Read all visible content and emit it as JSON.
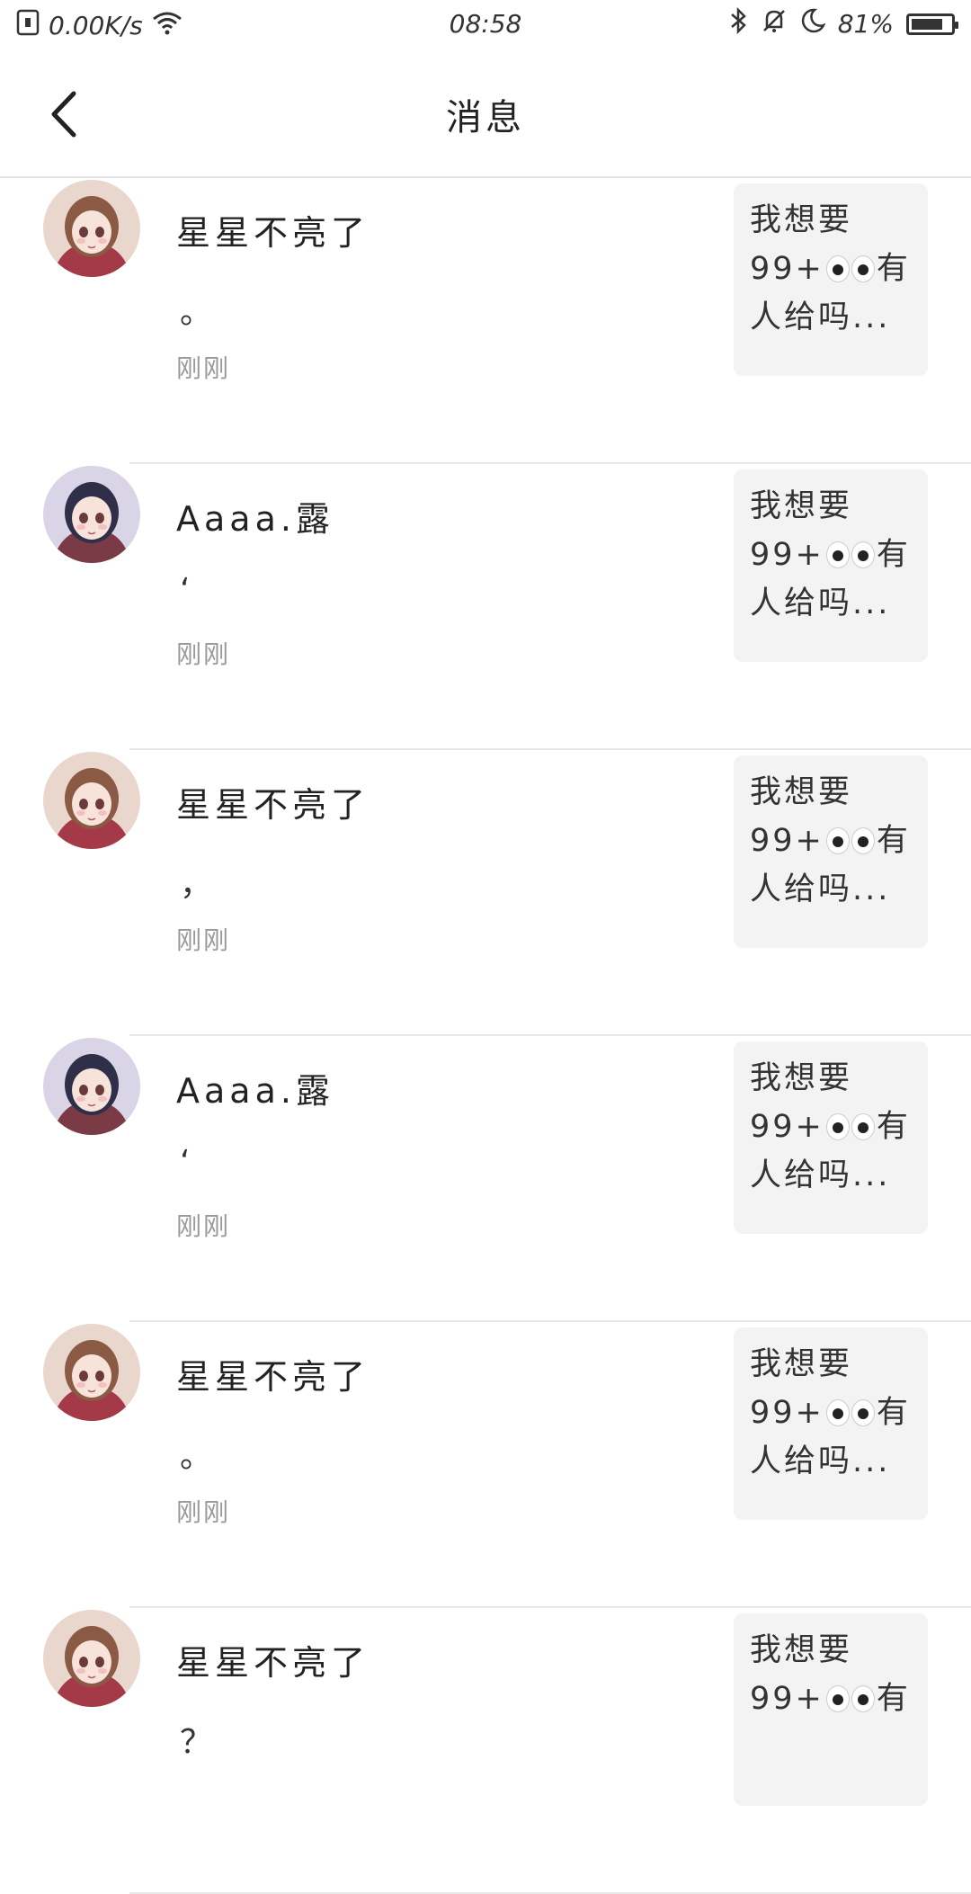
{
  "status_bar": {
    "net_speed": "0.00K/s",
    "time": "08:58",
    "battery": "81%",
    "battery_level": 0.81,
    "icons": [
      "sim-icon",
      "wifi-icon",
      "bluetooth-icon",
      "bell-off-icon",
      "moon-icon",
      "battery-icon"
    ]
  },
  "header": {
    "title": "消息",
    "back_icon": "chevron-left-icon"
  },
  "messages": [
    {
      "name": "星星不亮了",
      "avatar": "brown-hair-girl",
      "text": "。",
      "time": "刚刚",
      "preview": {
        "line1": "我想要",
        "line2_prefix": "99+",
        "line2_suffix": "有",
        "line3": "人给吗..."
      }
    },
    {
      "name": "Aaaa.露",
      "avatar": "dark-hair-girl",
      "text": "‘",
      "time": "刚刚",
      "preview": {
        "line1": "我想要",
        "line2_prefix": "99+",
        "line2_suffix": "有",
        "line3": "人给吗..."
      }
    },
    {
      "name": "星星不亮了",
      "avatar": "brown-hair-girl",
      "text": "，",
      "time": "刚刚",
      "preview": {
        "line1": "我想要",
        "line2_prefix": "99+",
        "line2_suffix": "有",
        "line3": "人给吗..."
      }
    },
    {
      "name": "Aaaa.露",
      "avatar": "dark-hair-girl",
      "text": "‘",
      "time": "刚刚",
      "preview": {
        "line1": "我想要",
        "line2_prefix": "99+",
        "line2_suffix": "有",
        "line3": "人给吗..."
      }
    },
    {
      "name": "星星不亮了",
      "avatar": "brown-hair-girl",
      "text": "。",
      "time": "刚刚",
      "preview": {
        "line1": "我想要",
        "line2_prefix": "99+",
        "line2_suffix": "有",
        "line3": "人给吗..."
      }
    },
    {
      "name": "星星不亮了",
      "avatar": "brown-hair-girl",
      "text": "？",
      "time": "",
      "preview": {
        "line1": "我想要",
        "line2_prefix": "99+",
        "line2_suffix": "有",
        "line3": ""
      }
    }
  ]
}
